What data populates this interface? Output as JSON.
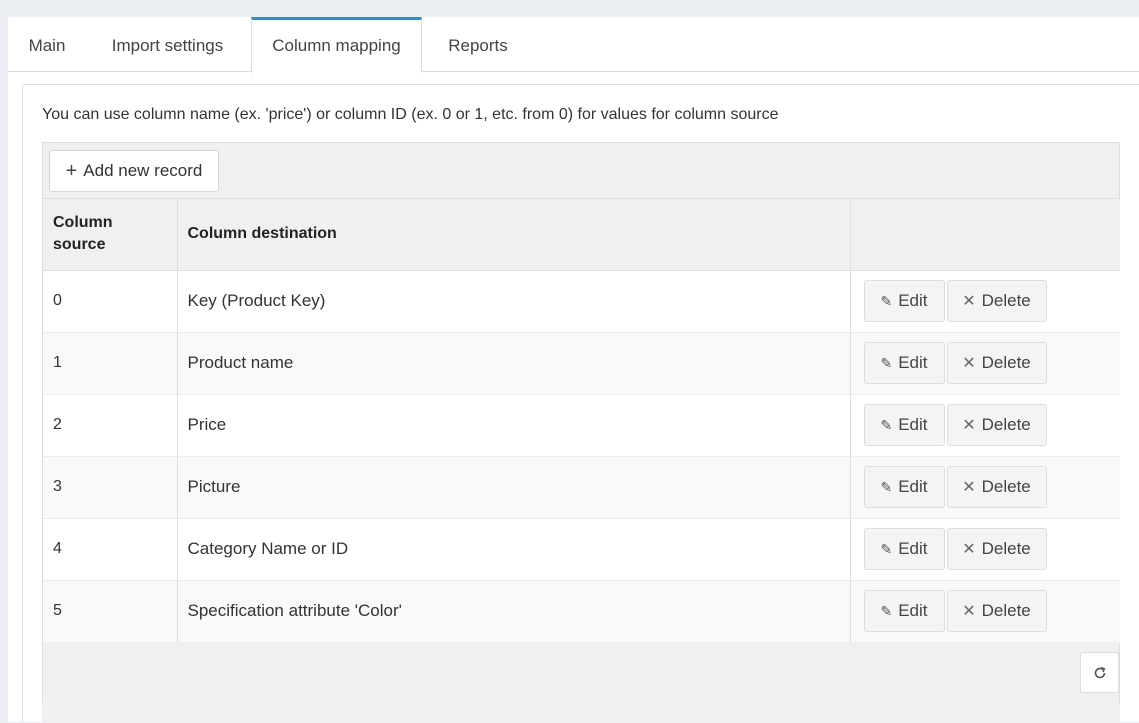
{
  "tabs": [
    {
      "label": "Main"
    },
    {
      "label": "Import settings"
    },
    {
      "label": "Column mapping"
    },
    {
      "label": "Reports"
    }
  ],
  "active_tab": "Column mapping",
  "hint": "You can use column name (ex. 'price') or column ID (ex. 0 or 1, etc. from 0) for values for column source",
  "toolbar": {
    "add_label": "Add new record",
    "add_icon": "plus-icon"
  },
  "table": {
    "headers": {
      "source": "Column source",
      "destination": "Column destination",
      "actions": ""
    },
    "rows": [
      {
        "source": "0",
        "destination": "Key (Product Key)"
      },
      {
        "source": "1",
        "destination": "Product name"
      },
      {
        "source": "2",
        "destination": "Price"
      },
      {
        "source": "3",
        "destination": "Picture"
      },
      {
        "source": "4",
        "destination": "Category Name or ID"
      },
      {
        "source": "5",
        "destination": "Specification attribute 'Color'"
      }
    ],
    "edit_label": "Edit",
    "delete_label": "Delete"
  },
  "icons": {
    "edit": "pencil-icon",
    "delete": "x-icon",
    "refresh": "refresh-icon"
  },
  "colors": {
    "active_tab_accent": "#3c8dbc",
    "grid_background": "#f0f0f0"
  }
}
